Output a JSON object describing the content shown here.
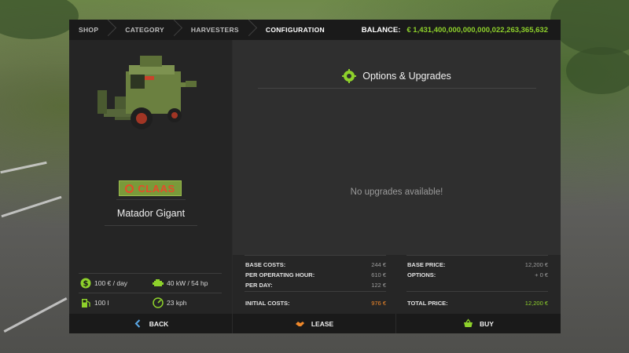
{
  "breadcrumbs": [
    {
      "label": "SHOP"
    },
    {
      "label": "CATEGORY"
    },
    {
      "label": "HARVESTERS"
    },
    {
      "label": "CONFIGURATION"
    }
  ],
  "balance": {
    "label": "BALANCE:",
    "value": "€ 1,431,400,000,000,000,022,263,365,632"
  },
  "vehicle": {
    "brand": "CLAAS",
    "model": "Matador Gigant",
    "icon": "combine-harvester-image"
  },
  "specs": {
    "cost_per_day": "100 € / day",
    "power": "40 kW / 54 hp",
    "capacity": "100 l",
    "speed": "23 kph"
  },
  "options": {
    "title": "Options & Upgrades",
    "empty_message": "No upgrades available!"
  },
  "costs": {
    "base_costs_label": "BASE COSTS:",
    "base_costs": "244 €",
    "per_operating_hour_label": "PER OPERATING HOUR:",
    "per_operating_hour": "610 €",
    "per_day_label": "PER DAY:",
    "per_day": "122 €",
    "initial_costs_label": "INITIAL COSTS:",
    "initial_costs": "976 €",
    "base_price_label": "BASE PRICE:",
    "base_price": "12,200 €",
    "options_label": "OPTIONS:",
    "options": "+ 0 €",
    "total_price_label": "TOTAL PRICE:",
    "total_price": "12,200 €"
  },
  "actions": {
    "back": "BACK",
    "lease": "LEASE",
    "buy": "BUY"
  },
  "colors": {
    "accent_green": "#8ed12b",
    "accent_orange": "#f0882a",
    "brand_red": "#e64b2a"
  }
}
